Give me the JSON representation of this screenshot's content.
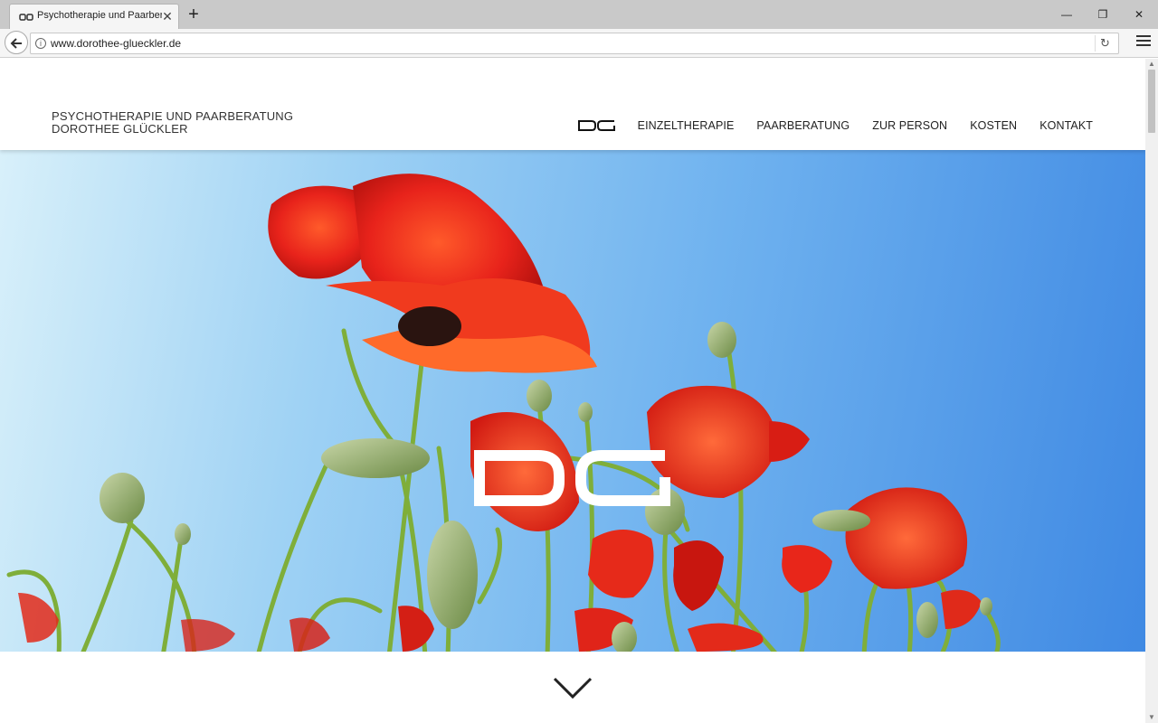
{
  "browser": {
    "tab_title": "Psychotherapie und Paarberatung",
    "url": "www.dorothee-glueckler.de",
    "new_tab_icon": "plus-icon",
    "window_controls": [
      "minimize-icon",
      "restore-icon",
      "close-icon"
    ]
  },
  "site": {
    "brand_line1": "PSYCHOTHERAPIE UND PAARBERATUNG",
    "brand_line2": "DOROTHEE GLÜCKLER",
    "logo_text": "DG",
    "nav": [
      {
        "label": "EINZELTHERAPIE"
      },
      {
        "label": "PAARBERATUNG"
      },
      {
        "label": "ZUR PERSON"
      },
      {
        "label": "KOSTEN"
      },
      {
        "label": "KONTAKT"
      }
    ]
  },
  "hero": {
    "image": "poppies against blue sky",
    "logo_text": "DG",
    "colors": {
      "sky_light": "#d8f0fa",
      "sky_dark": "#3f89e3",
      "poppy": "#e8291c",
      "stem": "#7fae3a"
    }
  },
  "scroll_down_icon": "chevron-down-icon"
}
